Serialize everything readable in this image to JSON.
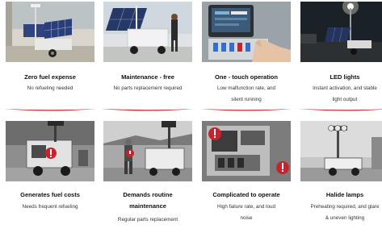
{
  "accent_color": "#c8232c",
  "row1": [
    {
      "title": "Zero fuel expense",
      "desc": [
        "No refueling needed"
      ],
      "image": "solar light tower with four solar panels outdoors"
    },
    {
      "title": "Maintenance - free",
      "desc": [
        "No parts replacement required"
      ],
      "image": "solar light tower trailer with technician"
    },
    {
      "title": "One - touch operation",
      "desc": [
        "Low malfunction rate, and",
        "silent running"
      ],
      "image": "hand pressing control panel switches"
    },
    {
      "title": "LED lights",
      "desc": [
        "Instant activation, and stable",
        "light output"
      ],
      "image": "solar light tower illuminated at night"
    }
  ],
  "row2": [
    {
      "title": "Generates fuel costs",
      "desc": [
        "Needs frequent refueling"
      ],
      "image": "diesel light tower generator in grayscale"
    },
    {
      "title": "Demands routine",
      "title2": "maintenance",
      "desc": [
        "Regular parts replacement"
      ],
      "image": "worker servicing diesel light tower"
    },
    {
      "title": "Complicated to operate",
      "desc": [
        "High failure rate, and loud",
        "noise"
      ],
      "image": "diesel engine compartment with red warning icon"
    },
    {
      "title": "Halide lamps",
      "desc": [
        "Preheating required, and glare",
        "& uneven lighting"
      ],
      "image": "metal halide lamp light tower raised mast"
    }
  ]
}
